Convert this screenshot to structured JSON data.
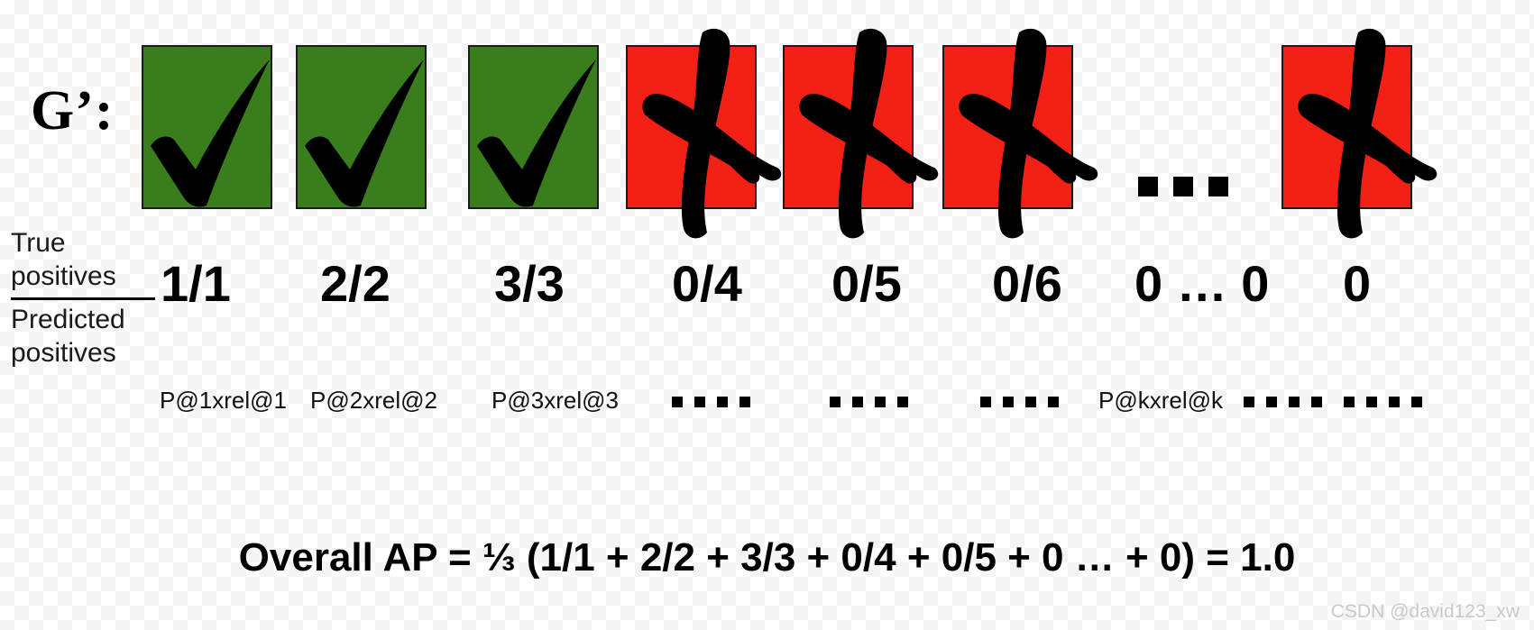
{
  "slide": {
    "group_label": "G’:",
    "fraction_label": {
      "numerator": "True positives",
      "denominator": "Predicted positives"
    },
    "items": [
      {
        "mark": "check",
        "box_color": "#3a7d1c",
        "ratio": "1/1",
        "caption": "P@1xrel@1"
      },
      {
        "mark": "check",
        "box_color": "#3a7d1c",
        "ratio": "2/2",
        "caption": "P@2xrel@2"
      },
      {
        "mark": "check",
        "box_color": "#3a7d1c",
        "ratio": "3/3",
        "caption": "P@3xrel@3"
      },
      {
        "mark": "cross",
        "box_color": "#f22015",
        "ratio": "0/4",
        "caption": "...."
      },
      {
        "mark": "cross",
        "box_color": "#f22015",
        "ratio": "0/5",
        "caption": "...."
      },
      {
        "mark": "cross",
        "box_color": "#f22015",
        "ratio": "0/6",
        "caption": "...."
      },
      {
        "mark": "ellipsis",
        "box_color": "",
        "ratio": "0 … 0",
        "caption": "P@kxrel@k"
      },
      {
        "mark": "cross",
        "box_color": "#f22015",
        "ratio": "0",
        "caption": "...."
      }
    ],
    "trailing_caption_dots": "....",
    "overall_formula": "Overall AP = ⅓ (1/1 + 2/2 + 3/3 + 0/4 + 0/5 + 0 … + 0) =  1.0",
    "watermark": "CSDN @david123_xw"
  },
  "colors": {
    "green": "#3a7d1c",
    "red": "#f22015",
    "mark_black": "#000000",
    "box_border": "#1b1b1b",
    "watermark": "#c9c9c9"
  }
}
